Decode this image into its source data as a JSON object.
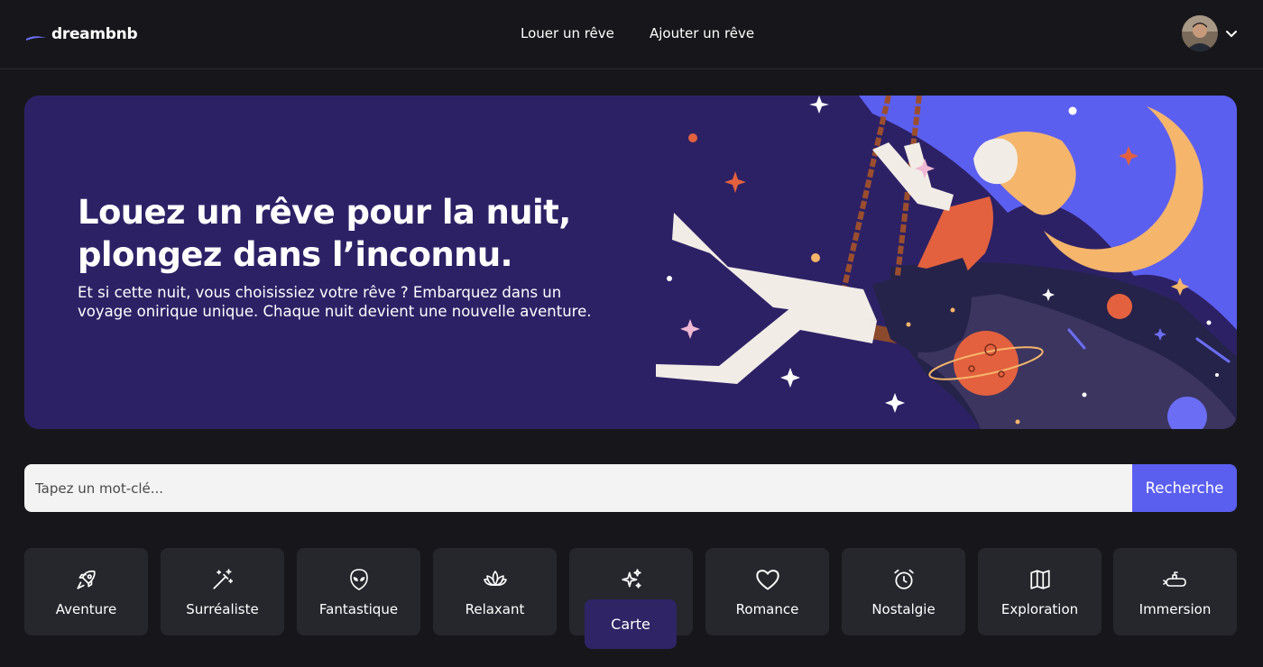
{
  "brand": {
    "name": "dreambnb",
    "logo_icon": "moon-logo-icon"
  },
  "nav": {
    "rent": "Louer un rêve",
    "add": "Ajouter un rêve"
  },
  "user": {
    "avatar": "user-avatar",
    "menu_icon": "chevron-down-icon"
  },
  "hero": {
    "title_line1": "Louez un rêve pour la nuit,",
    "title_line2": "plongez dans l’inconnu.",
    "subtitle_line1": "Et si cette nuit, vous choisissiez votre rêve ? Embarquez dans un",
    "subtitle_line2": "voyage onirique unique. Chaque nuit devient une nouvelle aventure.",
    "background": "#2d2166"
  },
  "search": {
    "placeholder": "Tapez un mot-clé...",
    "button": "Recherche",
    "accent": "#5b5ff0"
  },
  "categories": [
    {
      "label": "Aventure",
      "icon": "rocket-icon"
    },
    {
      "label": "Surréaliste",
      "icon": "magic-wand-icon"
    },
    {
      "label": "Fantastique",
      "icon": "alien-icon"
    },
    {
      "label": "Relaxant",
      "icon": "lotus-icon"
    },
    {
      "label": "",
      "icon": "sparkles-icon"
    },
    {
      "label": "Romance",
      "icon": "heart-icon"
    },
    {
      "label": "Nostalgie",
      "icon": "alarm-clock-icon"
    },
    {
      "label": "Exploration",
      "icon": "map-icon"
    },
    {
      "label": "Immersion",
      "icon": "submarine-icon"
    }
  ],
  "map_button": {
    "label": "Carte"
  }
}
